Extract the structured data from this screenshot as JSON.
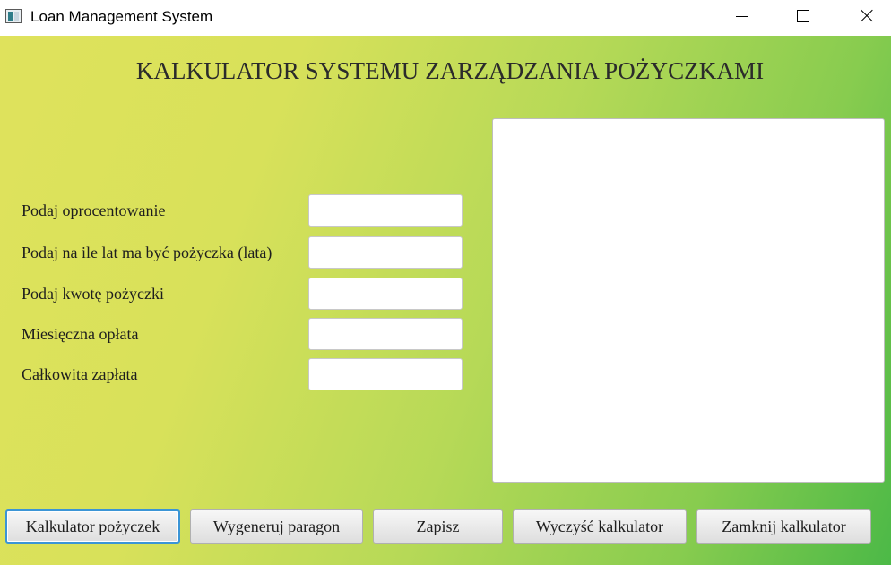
{
  "window": {
    "title": "Loan Management System"
  },
  "main": {
    "heading": "KALKULATOR SYSTEMU ZARZĄDZANIA POŻYCZKAMI"
  },
  "form": {
    "fields": [
      {
        "label": "Podaj oprocentowanie",
        "value": ""
      },
      {
        "label": "Podaj na ile lat ma być pożyczka (lata)",
        "value": ""
      },
      {
        "label": "Podaj kwotę pożyczki",
        "value": ""
      },
      {
        "label": "Miesięczna opłata",
        "value": ""
      },
      {
        "label": "Całkowita zapłata",
        "value": ""
      }
    ]
  },
  "receipt": {
    "text": ""
  },
  "buttons": {
    "calculate": "Kalkulator pożyczek",
    "generate_receipt": "Wygeneruj paragon",
    "save": "Zapisz",
    "clear": "Wyczyść kalkulator",
    "close": "Zamknij kalkulator"
  },
  "icons": {
    "app": "app-window-icon",
    "minimize": "minimize-icon",
    "maximize": "maximize-icon",
    "close": "close-icon"
  },
  "colors": {
    "gradient_start": "#dfe25c",
    "gradient_end": "#4cb947",
    "focus_ring": "#3b95d6"
  }
}
